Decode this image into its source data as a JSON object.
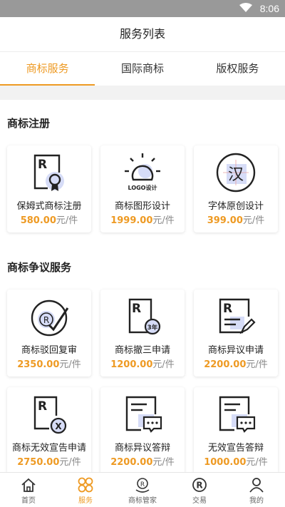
{
  "status": {
    "time": "8:06"
  },
  "header": {
    "title": "服务列表"
  },
  "tabs": [
    {
      "label": "商标服务",
      "active": true
    },
    {
      "label": "国际商标",
      "active": false
    },
    {
      "label": "版权服务",
      "active": false
    }
  ],
  "sections": [
    {
      "title": "商标注册",
      "cards": [
        {
          "name": "保姆式商标注册",
          "price": "580.00",
          "unit": "元/件",
          "icon": "trademark-doc-badge-icon"
        },
        {
          "name": "商标图形设计",
          "price": "1999.00",
          "unit": "元/件",
          "icon": "logo-design-icon",
          "icon_text": "LOGO设计"
        },
        {
          "name": "字体原创设计",
          "price": "399.00",
          "unit": "元/件",
          "icon": "font-design-icon",
          "icon_text": "汉"
        }
      ]
    },
    {
      "title": "商标争议服务",
      "cards": [
        {
          "name": "商标驳回复审",
          "price": "2350.00",
          "unit": "元/件",
          "icon": "registered-check-icon",
          "icon_text": "R"
        },
        {
          "name": "商标撤三申请",
          "price": "1200.00",
          "unit": "元/件",
          "icon": "trademark-3year-icon",
          "icon_text": "3年"
        },
        {
          "name": "商标异议申请",
          "price": "2200.00",
          "unit": "元/件",
          "icon": "trademark-edit-icon"
        },
        {
          "name": "商标无效宣告申请",
          "price": "2750.00",
          "unit": "元/件",
          "icon": "trademark-invalid-icon",
          "icon_text": "X"
        },
        {
          "name": "商标异议答辩",
          "price": "2200.00",
          "unit": "元/件",
          "icon": "doc-comment-icon"
        },
        {
          "name": "无效宣告答辩",
          "price": "1000.00",
          "unit": "元/件",
          "icon": "doc-comment-icon"
        }
      ]
    }
  ],
  "bottom_nav": [
    {
      "label": "首页",
      "icon": "home-icon",
      "active": false
    },
    {
      "label": "服务",
      "icon": "services-icon",
      "active": true
    },
    {
      "label": "商标管家",
      "icon": "trademark-manager-icon",
      "active": false
    },
    {
      "label": "交易",
      "icon": "trade-icon",
      "active": false
    },
    {
      "label": "我的",
      "icon": "profile-icon",
      "active": false
    }
  ],
  "colors": {
    "accent": "#ee9a23",
    "status_bar": "#999999",
    "icon_blob": "#d6dcf7"
  }
}
